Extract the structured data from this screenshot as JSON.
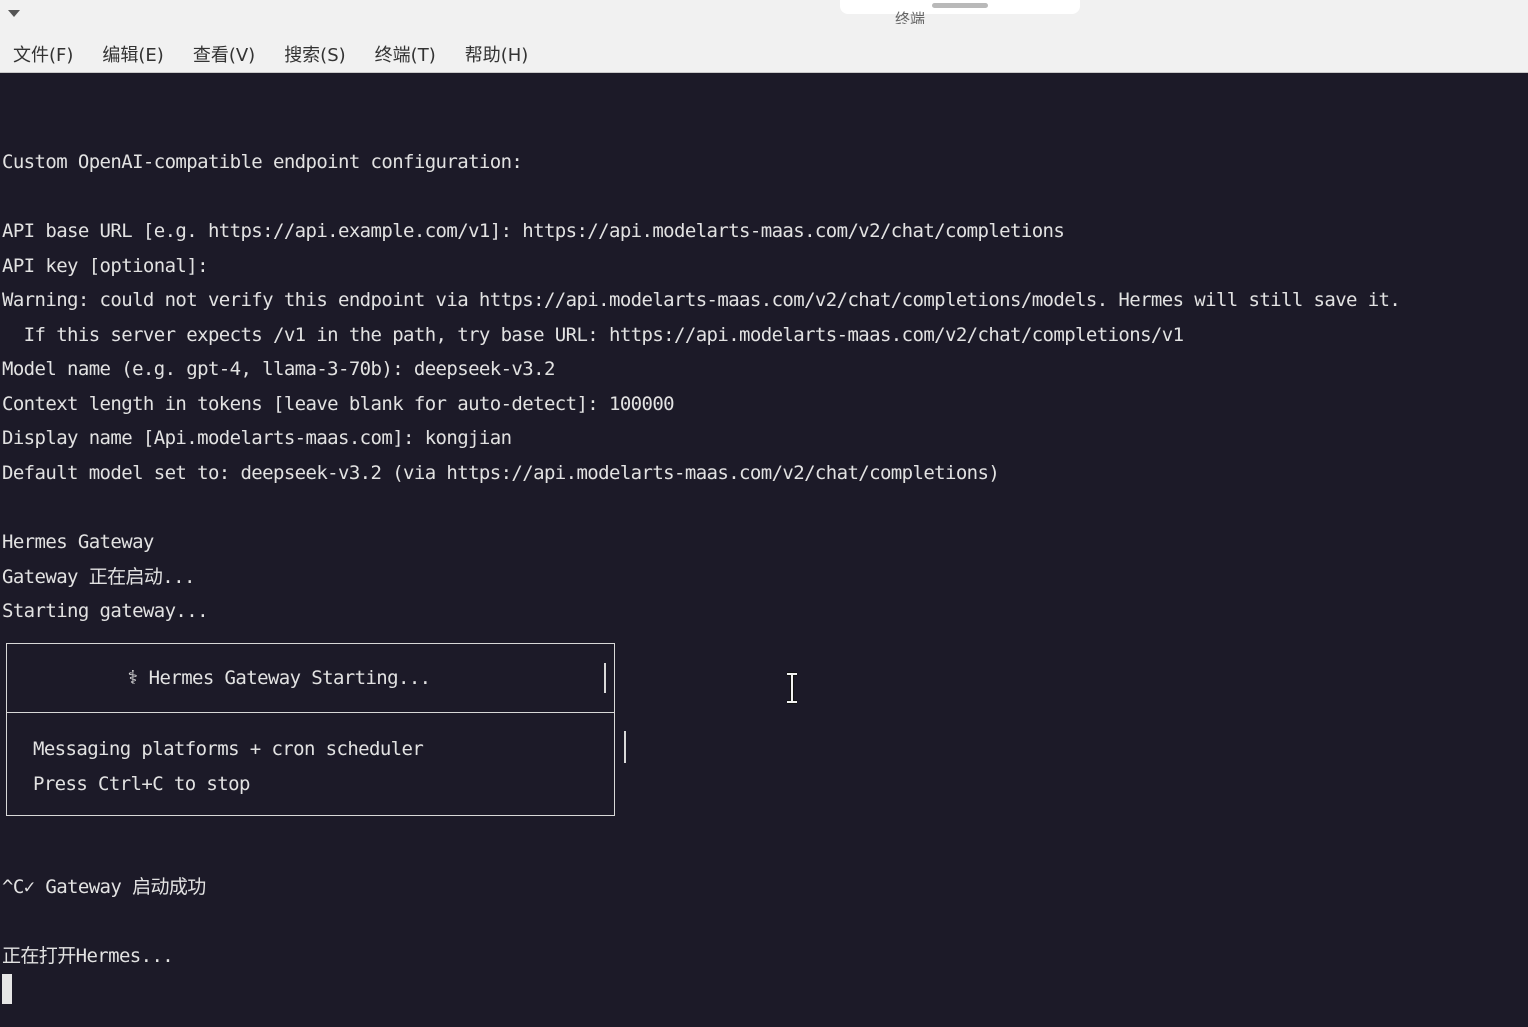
{
  "window": {
    "title": "终端"
  },
  "menu": {
    "items": [
      "文件(F)",
      "编辑(E)",
      "查看(V)",
      "搜索(S)",
      "终端(T)",
      "帮助(H)"
    ]
  },
  "terminal": {
    "lines": [
      "Custom OpenAI-compatible endpoint configuration:",
      "API base URL [e.g. https://api.example.com/v1]: https://api.modelarts-maas.com/v2/chat/completions",
      "API key [optional]:",
      "Warning: could not verify this endpoint via https://api.modelarts-maas.com/v2/chat/completions/models. Hermes will still save it.",
      "  If this server expects /v1 in the path, try base URL: https://api.modelarts-maas.com/v2/chat/completions/v1",
      "Model name (e.g. gpt-4, llama-3-70b): deepseek-v3.2",
      "Context length in tokens [leave blank for auto-detect]: 100000",
      "Display name [Api.modelarts-maas.com]: kongjian",
      "Default model set to: deepseek-v3.2 (via https://api.modelarts-maas.com/v2/chat/completions)",
      "Hermes Gateway",
      "Gateway 正在启动...",
      "Starting gateway...",
      "^C✓ Gateway 启动成功",
      "正在打开Hermes..."
    ],
    "banner": {
      "title": "⚕ Hermes Gateway Starting...",
      "line1": "Messaging platforms + cron scheduler",
      "line2": "Press Ctrl+C to stop"
    }
  }
}
